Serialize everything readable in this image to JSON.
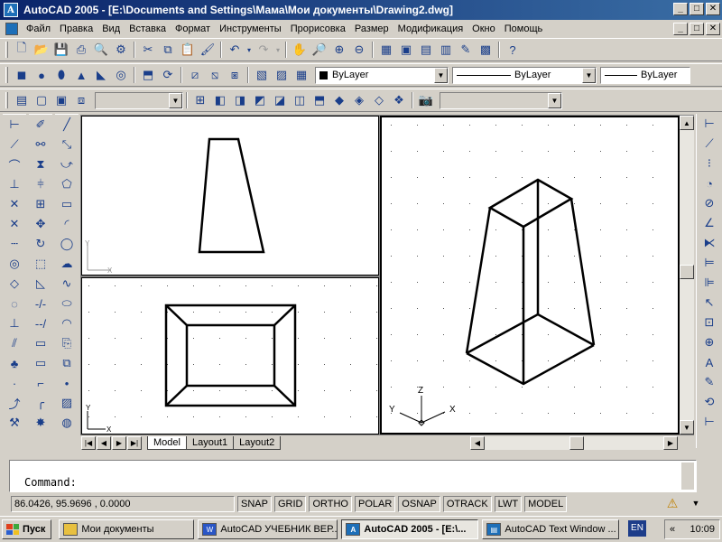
{
  "window": {
    "title": "AutoCAD 2005 - [E:\\Documents and Settings\\Мама\\Мои документы\\Drawing2.dwg]",
    "minimize": "_",
    "maximize": "□",
    "close": "✕"
  },
  "menu": {
    "items": [
      "Файл",
      "Правка",
      "Вид",
      "Вставка",
      "Формат",
      "Инструменты",
      "Прорисовка",
      "Размер",
      "Модификация",
      "Окно",
      "Помощь"
    ]
  },
  "layers": {
    "color": "ByLayer",
    "linetype": "ByLayer",
    "lineweight": "ByLayer"
  },
  "viewports": {
    "iso_axes": {
      "z": "Z",
      "y": "Y",
      "x": "X"
    },
    "ucs_small": {
      "y": "Y",
      "x": "X"
    }
  },
  "tabs": [
    "Model",
    "Layout1",
    "Layout2"
  ],
  "command": {
    "prompt": "Command:"
  },
  "status": {
    "coords": "86.0426,  95.9696 , 0.0000",
    "modes": [
      "SNAP",
      "GRID",
      "ORTHO",
      "POLAR",
      "OSNAP",
      "OTRACK",
      "LWT",
      "MODEL"
    ]
  },
  "taskbar": {
    "start": "Пуск",
    "tasks": [
      {
        "label": "Мои документы",
        "icon": "folder-icon",
        "color": "#e8c040"
      },
      {
        "label": "AutoCAD УЧЕБНИК ВЕР...",
        "icon": "word-icon",
        "color": "#2a56c6"
      },
      {
        "label": "AutoCAD 2005 - [E:\\...",
        "icon": "autocad-icon",
        "color": "#1d6fb8"
      },
      {
        "label": "AutoCAD Text Window ...",
        "icon": "text-window-icon",
        "color": "#1d6fb8"
      }
    ],
    "lang": "EN",
    "time": "10:09",
    "tray_collapse": "«"
  },
  "colors": {
    "title_start": "#0a246a",
    "title_end": "#3a6ea5",
    "chrome": "#d4d0c8"
  }
}
